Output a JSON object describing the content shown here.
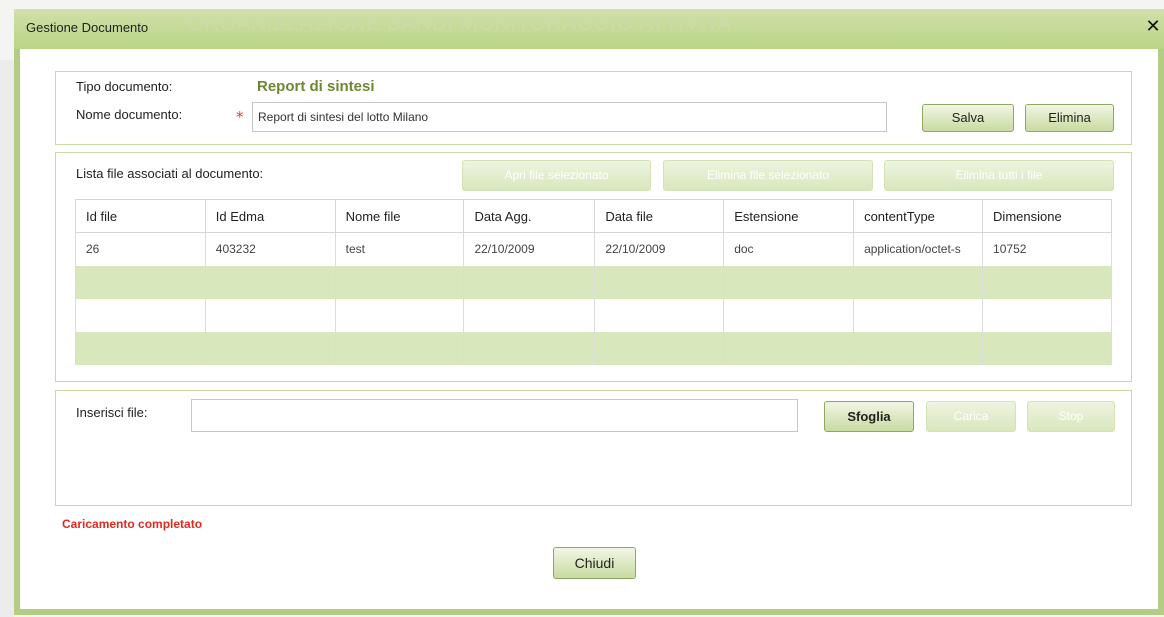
{
  "dialog": {
    "title": "Gestione Documento",
    "background_heading": "ORGANIZZAZIONE BANDI MONITORAGGIO ATTIVITA'",
    "close_symbol": "✕"
  },
  "document": {
    "tipo_label": "Tipo documento:",
    "tipo_value": "Report di sintesi",
    "nome_label": "Nome documento:",
    "required_mark": "*",
    "nome_value": "Report di sintesi del lotto Milano",
    "save_label": "Salva",
    "delete_label": "Elimina"
  },
  "files": {
    "list_label": "Lista file associati al documento:",
    "open_selected_label": "Apri file selezionato",
    "delete_selected_label": "Elimina file selezionato",
    "delete_all_label": "Elimina tutti i file",
    "columns": [
      "Id file",
      "Id Edma",
      "Nome file",
      "Data Agg.",
      "Data file",
      "Estensione",
      "contentType",
      "Dimensione"
    ],
    "rows": [
      [
        "26",
        "403232",
        "test",
        "22/10/2009",
        "22/10/2009",
        "doc",
        "application/octet-s",
        "10752"
      ],
      [
        "",
        "",
        "",
        "",
        "",
        "",
        "",
        ""
      ],
      [
        "",
        "",
        "",
        "",
        "",
        "",
        "",
        ""
      ],
      [
        "",
        "",
        "",
        "",
        "",
        "",
        "",
        ""
      ]
    ]
  },
  "upload": {
    "label": "Inserisci file:",
    "input_value": "",
    "browse_label": "Sfoglia",
    "upload_label": "Carica",
    "stop_label": "Stop"
  },
  "status": {
    "message": "Caricamento completato",
    "color": "#e02a1f"
  },
  "footer": {
    "close_label": "Chiudi"
  },
  "colors": {
    "accent": "#b4cc84",
    "row_alt": "#d9e7bd",
    "tipo_value": "#6a8a32"
  }
}
